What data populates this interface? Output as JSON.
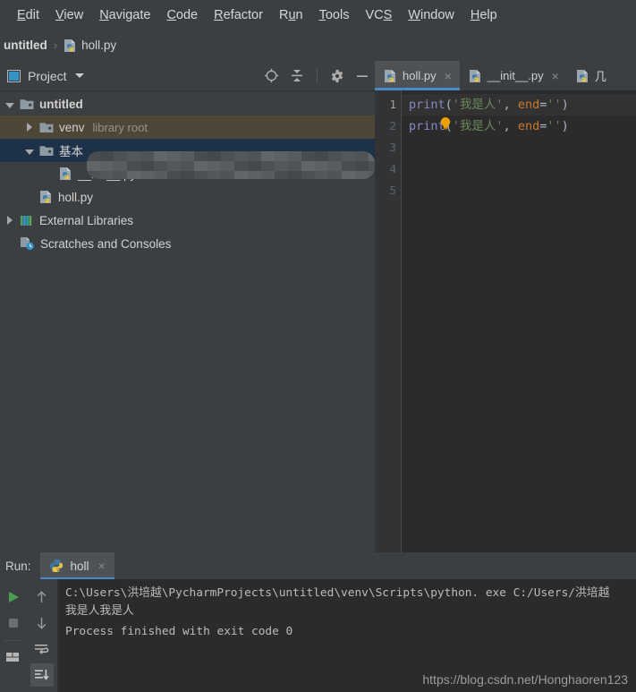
{
  "menu": {
    "items": [
      {
        "pre": "",
        "mn": "E",
        "post": "dit"
      },
      {
        "pre": "",
        "mn": "V",
        "post": "iew"
      },
      {
        "pre": "",
        "mn": "N",
        "post": "avigate"
      },
      {
        "pre": "",
        "mn": "C",
        "post": "ode"
      },
      {
        "pre": "",
        "mn": "R",
        "post": "efactor"
      },
      {
        "pre": "R",
        "mn": "u",
        "post": "n"
      },
      {
        "pre": "",
        "mn": "T",
        "post": "ools"
      },
      {
        "pre": "VC",
        "mn": "S",
        "post": ""
      },
      {
        "pre": "",
        "mn": "W",
        "post": "indow"
      },
      {
        "pre": "",
        "mn": "H",
        "post": "elp"
      }
    ]
  },
  "breadcrumb": {
    "project": "untitled",
    "separator": "›",
    "file": "holl.py"
  },
  "project_panel": {
    "title": "Project",
    "icons": [
      "target-icon",
      "collapse-all-icon",
      "gear-icon",
      "minimize-icon"
    ],
    "tree": [
      {
        "label": "untitled",
        "sub": "",
        "depth": 0,
        "arrow": "down",
        "icon": "folder-project-icon",
        "state": "none",
        "bold": true
      },
      {
        "label": "venv",
        "sub": "library root",
        "depth": 1,
        "arrow": "right",
        "icon": "folder-module-icon",
        "state": "venv",
        "bold": false
      },
      {
        "label": "基本",
        "sub": "",
        "depth": 1,
        "arrow": "down",
        "icon": "folder-module-icon",
        "state": "selected",
        "bold": false
      },
      {
        "label": "__init__.py",
        "sub": "",
        "depth": 2,
        "arrow": "none",
        "icon": "python-file-icon",
        "state": "none",
        "bold": false
      },
      {
        "label": "holl.py",
        "sub": "",
        "depth": 1,
        "arrow": "none",
        "icon": "python-file-icon",
        "state": "none",
        "bold": false
      },
      {
        "label": "External Libraries",
        "sub": "",
        "depth": 0,
        "arrow": "right",
        "icon": "libraries-icon",
        "state": "none",
        "bold": false
      },
      {
        "label": "Scratches and Consoles",
        "sub": "",
        "depth": 0,
        "arrow": "none",
        "icon": "scratches-icon",
        "state": "none",
        "bold": false
      }
    ]
  },
  "editor": {
    "tabs": [
      {
        "label": "holl.py",
        "active": true,
        "close": "×"
      },
      {
        "label": "__init__.py",
        "active": false,
        "close": "×"
      },
      {
        "label": "几",
        "active": false,
        "close": ""
      }
    ],
    "line_numbers": [
      "1",
      "2",
      "3",
      "4",
      "5"
    ],
    "code_lines": [
      {
        "fn": "print",
        "open": "(",
        "str": "'我是人'",
        "comma": ", ",
        "kw": "end",
        "eq": "=",
        "empty": "''",
        "close": ")"
      },
      {
        "fn": "print",
        "open": "(",
        "str": "'我是人'",
        "comma": ", ",
        "kw": "end",
        "eq": "=",
        "empty": "''",
        "close": ")"
      }
    ],
    "bulb": "intention-bulb-icon"
  },
  "run_panel": {
    "label": "Run:",
    "tab_label": "holl",
    "tab_close": "×",
    "tools_left": [
      "run-icon",
      "stop-icon",
      "print-icon"
    ],
    "tools_right": [
      "up-arrow-icon",
      "down-arrow-icon",
      "soft-wrap-icon",
      "scroll-to-end-icon"
    ],
    "console": [
      "C:\\Users\\洪培越\\PycharmProjects\\untitled\\venv\\Scripts\\python. exe C:/Users/洪培越",
      "我是人我是人",
      "Process finished with exit code 0"
    ]
  },
  "watermark": {
    "url": "https://blog.csdn.net/Honghaoren123"
  },
  "colors": {
    "bg_panel": "#3C3F41",
    "bg_editor": "#2B2B2B",
    "tab_active": "#4E5254",
    "accent": "#4A88C7",
    "tree_selected": "#1D3148",
    "tree_venv": "#4E4636",
    "code_function": "#8888C6",
    "code_string": "#6A8759",
    "code_keyword": "#CC7832",
    "code_punct": "#A9B7C6",
    "run_green": "#499C54"
  }
}
